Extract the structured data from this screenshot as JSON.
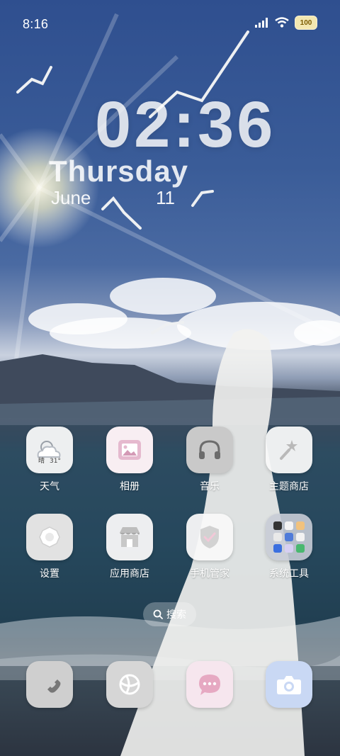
{
  "status_bar": {
    "time": "8:16",
    "battery": "100"
  },
  "clock_widget": {
    "time": "02:36",
    "weekday": "Thursday",
    "month": "June",
    "day": "11"
  },
  "apps": [
    {
      "label": "天气",
      "icon": "weather-icon",
      "temp": "31°",
      "weather": "晴"
    },
    {
      "label": "相册",
      "icon": "gallery-icon"
    },
    {
      "label": "音乐",
      "icon": "headphones-icon"
    },
    {
      "label": "主题商店",
      "icon": "theme-wand-icon"
    },
    {
      "label": "设置",
      "icon": "settings-flower-icon"
    },
    {
      "label": "应用商店",
      "icon": "app-store-icon"
    },
    {
      "label": "手机管家",
      "icon": "shield-check-icon"
    },
    {
      "label": "系统工具",
      "icon": "folder-icon"
    }
  ],
  "search": {
    "label": "搜索",
    "icon": "search-icon"
  },
  "dock": [
    {
      "icon": "phone-icon"
    },
    {
      "icon": "browser-icon"
    },
    {
      "icon": "messages-icon"
    },
    {
      "icon": "camera-icon"
    }
  ],
  "colors": {
    "accent_pink": "#f3dbe4",
    "camera_blue": "#c7d7f3",
    "sky": "#2f4f8f"
  }
}
